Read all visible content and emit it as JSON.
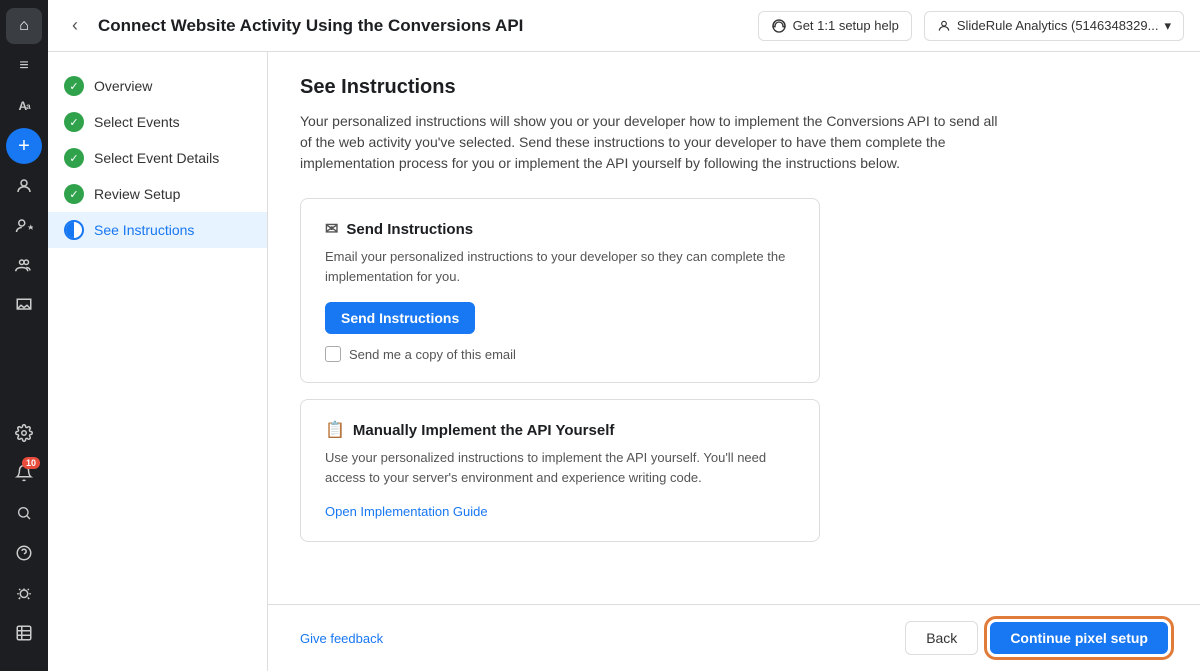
{
  "header": {
    "title": "Connect Website Activity Using the Conversions API",
    "help_button": "Get 1:1 setup help",
    "account_label": "SlideRule Analytics (5146348329...",
    "back_icon": "‹"
  },
  "steps": [
    {
      "id": "overview",
      "label": "Overview",
      "status": "completed"
    },
    {
      "id": "select-events",
      "label": "Select Events",
      "status": "completed"
    },
    {
      "id": "select-event-details",
      "label": "Select Event Details",
      "status": "completed"
    },
    {
      "id": "review-setup",
      "label": "Review Setup",
      "status": "completed"
    },
    {
      "id": "see-instructions",
      "label": "See Instructions",
      "status": "current"
    }
  ],
  "main": {
    "section_title": "See Instructions",
    "section_desc": "Your personalized instructions will show you or your developer how to implement the Conversions API to send all of the web activity you've selected. Send these instructions to your developer to have them complete the implementation process for you or implement the API yourself by following the instructions below.",
    "cards": [
      {
        "id": "send-instructions-card",
        "icon": "✉",
        "title": "Send Instructions",
        "desc": "Email your personalized instructions to your developer so they can complete the implementation for you.",
        "button_label": "Send Instructions",
        "checkbox_label": "Send me a copy of this email"
      },
      {
        "id": "manual-implement-card",
        "icon": "📋",
        "title": "Manually Implement the API Yourself",
        "desc": "Use your personalized instructions to implement the API yourself. You'll need access to your server's environment and experience writing code.",
        "link_label": "Open Implementation Guide"
      }
    ]
  },
  "footer": {
    "feedback_label": "Give feedback",
    "back_label": "Back",
    "continue_label": "Continue pixel setup"
  },
  "sidebar_icons": [
    {
      "id": "home",
      "icon": "⌂",
      "active": true
    },
    {
      "id": "menu",
      "icon": "≡",
      "active": false
    },
    {
      "id": "ads",
      "icon": "Aₐ",
      "active": false
    },
    {
      "id": "plus",
      "icon": "+",
      "circle": true
    },
    {
      "id": "people",
      "icon": "☺",
      "active": false
    },
    {
      "id": "person-star",
      "icon": "✦",
      "active": false
    },
    {
      "id": "group",
      "icon": "⚇",
      "active": false
    },
    {
      "id": "inbox",
      "icon": "⬡",
      "active": false
    }
  ],
  "sidebar_bottom_icons": [
    {
      "id": "settings",
      "icon": "⚙",
      "active": false
    },
    {
      "id": "notifications",
      "icon": "🔔",
      "badge": "10",
      "active": false
    },
    {
      "id": "search",
      "icon": "🔍",
      "active": false
    },
    {
      "id": "help",
      "icon": "?",
      "active": false
    },
    {
      "id": "bug",
      "icon": "🐛",
      "active": false
    },
    {
      "id": "table",
      "icon": "⊟",
      "active": false
    }
  ]
}
